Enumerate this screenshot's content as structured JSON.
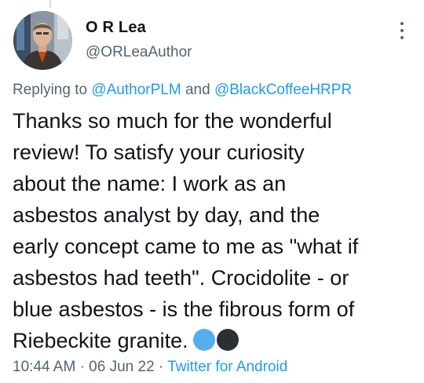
{
  "author": {
    "display_name": "O R Lea",
    "handle": "@ORLeaAuthor"
  },
  "reply": {
    "prefix": "Replying to",
    "mention_1": "@AuthorPLM",
    "conjunction": "and",
    "mention_2": "@BlackCoffeeHRPR"
  },
  "tweet": {
    "lines": [
      "Thanks so much for the wonderful",
      "review! To satisfy your curiosity",
      "about the name: I work as an",
      "asbestos analyst by day, and the",
      "early concept came to me as \"what if",
      "asbestos had teeth\". Crocidolite - or",
      "blue asbestos - is the fibrous form of",
      "Riebeckite granite."
    ],
    "emojis": [
      "blue-circle-emoji",
      "black-circle-emoji"
    ]
  },
  "meta": {
    "time": "10:44 AM",
    "separator": "·",
    "date": "06 Jun 22",
    "source": "Twitter for Android"
  },
  "colors": {
    "link": "#1d9bf0",
    "secondary_text": "#536471",
    "primary_text": "#0f1419",
    "emoji_blue": "#55acee",
    "emoji_black": "#292f33"
  },
  "icons": {
    "more": "more-vertical-icon"
  }
}
